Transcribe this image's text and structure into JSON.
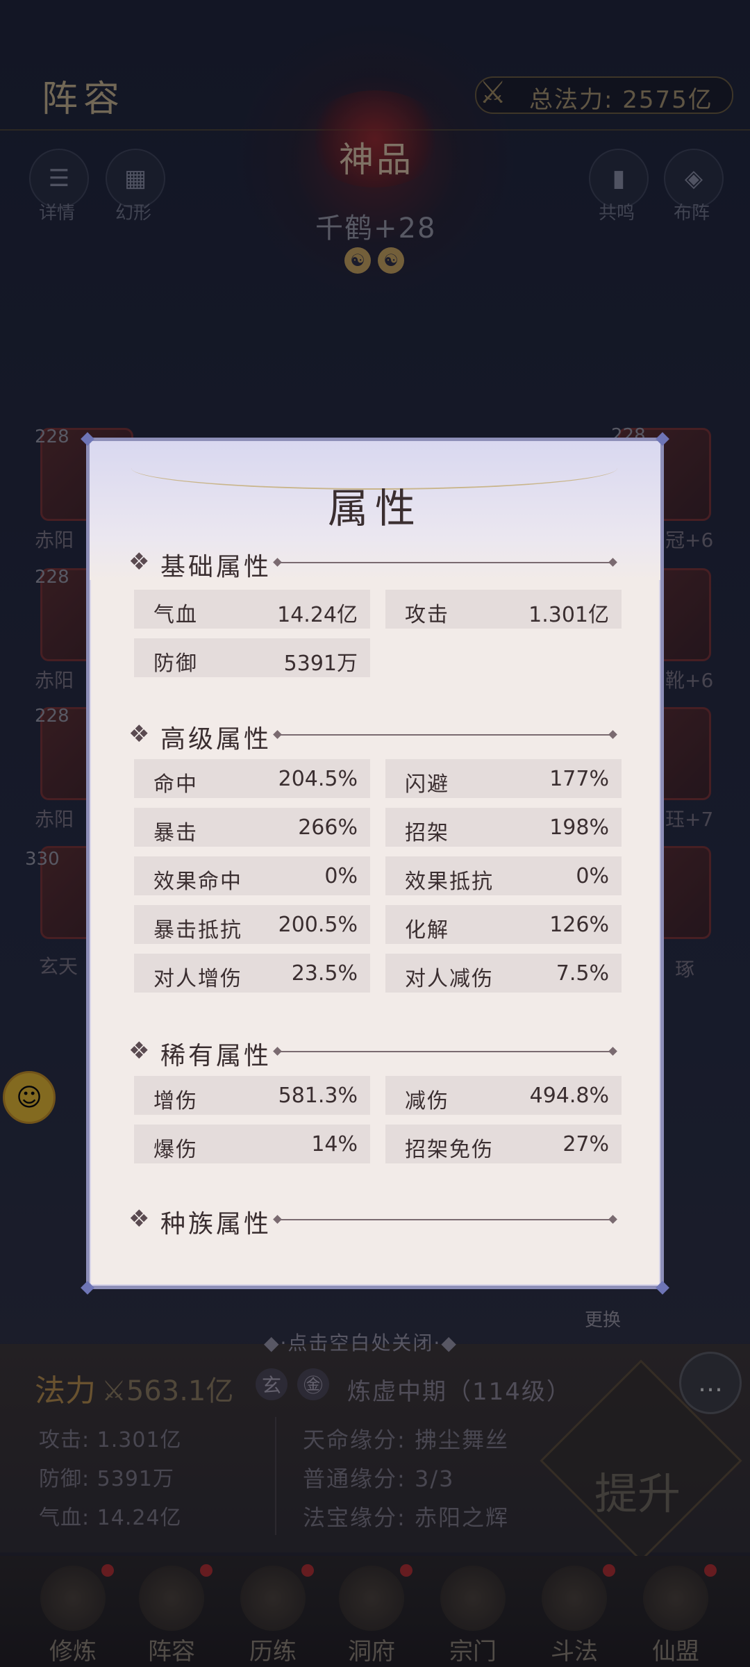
{
  "header": {
    "title": "阵容",
    "total_power_label": "总法力: 2575亿"
  },
  "top_buttons": {
    "details": "详情",
    "transform": "幻形",
    "resonance": "共鸣",
    "formation": "布阵"
  },
  "character": {
    "rank": "神品",
    "name": "千鹤+28",
    "yinyang_symbol": "☯"
  },
  "equipment_slots": [
    {
      "level": "228",
      "name": "赤阳"
    },
    {
      "level": "228",
      "name": "赤阳"
    },
    {
      "level": "228",
      "name": "赤阳"
    },
    {
      "level": "330",
      "name": "玄天"
    },
    {
      "level": "228",
      "name": "冠+6"
    },
    {
      "level": "",
      "name": "靴+6"
    },
    {
      "level": "",
      "name": "珏+7"
    },
    {
      "level": "",
      "name": "琢"
    }
  ],
  "modal": {
    "title": "属性",
    "sections": {
      "basic": {
        "title": "基础属性",
        "stats": [
          {
            "name": "气血",
            "value": "14.24亿"
          },
          {
            "name": "攻击",
            "value": "1.301亿"
          },
          {
            "name": "防御",
            "value": "5391万"
          }
        ]
      },
      "advanced": {
        "title": "高级属性",
        "stats": [
          {
            "name": "命中",
            "value": "204.5%"
          },
          {
            "name": "闪避",
            "value": "177%"
          },
          {
            "name": "暴击",
            "value": "266%"
          },
          {
            "name": "招架",
            "value": "198%"
          },
          {
            "name": "效果命中",
            "value": "0%"
          },
          {
            "name": "效果抵抗",
            "value": "0%"
          },
          {
            "name": "暴击抵抗",
            "value": "200.5%"
          },
          {
            "name": "化解",
            "value": "126%"
          },
          {
            "name": "对人增伤",
            "value": "23.5%"
          },
          {
            "name": "对人减伤",
            "value": "7.5%"
          }
        ]
      },
      "rare": {
        "title": "稀有属性",
        "stats": [
          {
            "name": "增伤",
            "value": "581.3%"
          },
          {
            "name": "减伤",
            "value": "494.8%"
          },
          {
            "name": "爆伤",
            "value": "14%"
          },
          {
            "name": "招架免伤",
            "value": "27%"
          }
        ]
      },
      "race": {
        "title": "种族属性"
      }
    }
  },
  "close_hint": "◆·点击空白处关闭·◆",
  "bottom": {
    "power_label": "法力",
    "power_value": "563.1亿",
    "realm_badge_1": "玄",
    "realm_badge_2": "㊎",
    "realm": "炼虚中期（114级）",
    "stats": {
      "attack": "攻击: 1.301亿",
      "defense": "防御: 5391万",
      "hp": "气血: 14.24亿"
    },
    "fate": {
      "destiny": "天命缘分: 拂尘舞丝",
      "normal": "普通缘分: 3/3",
      "treasure": "法宝缘分: 赤阳之辉"
    },
    "swap_label": "更换",
    "promote_label": "提升"
  },
  "tabs": [
    {
      "label": "修炼"
    },
    {
      "label": "阵容"
    },
    {
      "label": "历练"
    },
    {
      "label": "洞府"
    },
    {
      "label": "宗门"
    },
    {
      "label": "斗法"
    },
    {
      "label": "仙盟"
    }
  ],
  "icons": {
    "diamond": "❖",
    "chat": "…",
    "crossed_swords": "⚔"
  }
}
